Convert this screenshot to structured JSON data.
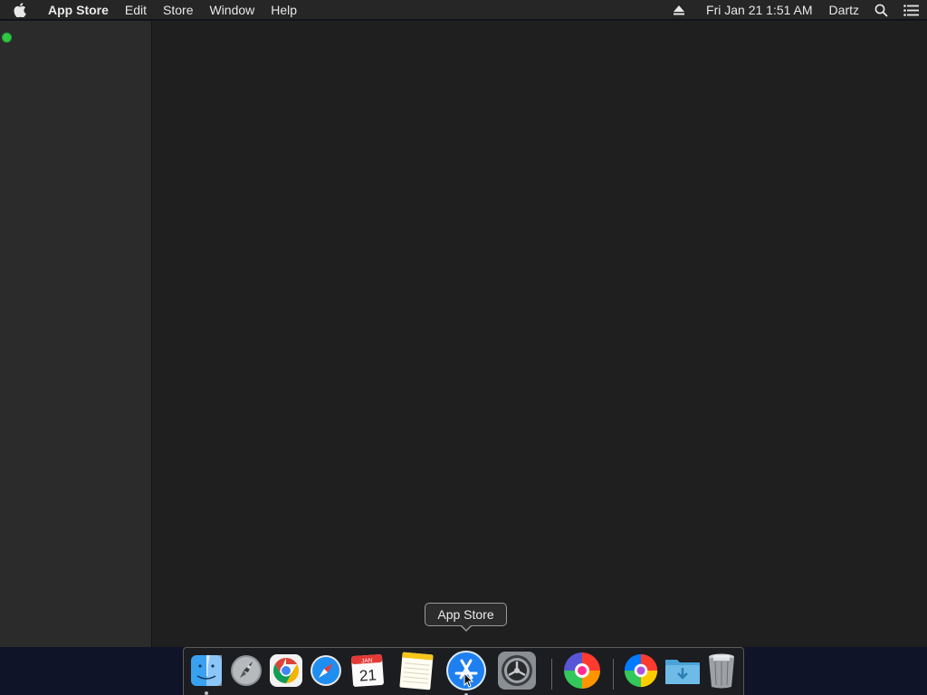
{
  "menubar": {
    "apple_icon": "apple-logo",
    "app_name": "App Store",
    "menus": [
      "Edit",
      "Store",
      "Window",
      "Help"
    ],
    "clock": "Fri Jan 21  1:51 AM",
    "user": "Dartz",
    "status_icons": [
      "eject-icon",
      "spotlight-search-icon",
      "notification-center-icon"
    ]
  },
  "window": {
    "traffic_lights_visible": [
      "green"
    ]
  },
  "tooltip": {
    "label": "App Store"
  },
  "dock": {
    "items": [
      {
        "name": "Finder",
        "icon": "finder-icon",
        "running": true
      },
      {
        "name": "Launchpad",
        "icon": "launchpad-icon",
        "running": false
      },
      {
        "name": "Google Chrome",
        "icon": "chrome-icon",
        "running": false
      },
      {
        "name": "Safari",
        "icon": "safari-icon",
        "running": false
      },
      {
        "name": "Calendar",
        "icon": "calendar-icon",
        "running": false,
        "month": "JAN",
        "day": "21"
      },
      {
        "name": "Notes",
        "icon": "notes-icon",
        "running": false
      },
      {
        "name": "App Store",
        "icon": "app-store-icon",
        "running": true
      },
      {
        "name": "System Preferences",
        "icon": "system-preferences-icon",
        "running": false
      },
      {
        "name": "Pinwheel App",
        "icon": "pinwheel-icon",
        "running": false
      },
      {
        "name": "Pinwheel App",
        "icon": "pinwheel-icon",
        "running": false
      },
      {
        "name": "Downloads",
        "icon": "downloads-folder-icon",
        "running": false
      },
      {
        "name": "Trash",
        "icon": "trash-icon",
        "running": false
      }
    ]
  },
  "colors": {
    "menubar_bg": "#262626",
    "window_bg": "#1f1f1f",
    "sidebar_bg": "#2b2b2b",
    "traffic_green": "#2fc844",
    "desktop_bg": "#0f1428"
  }
}
